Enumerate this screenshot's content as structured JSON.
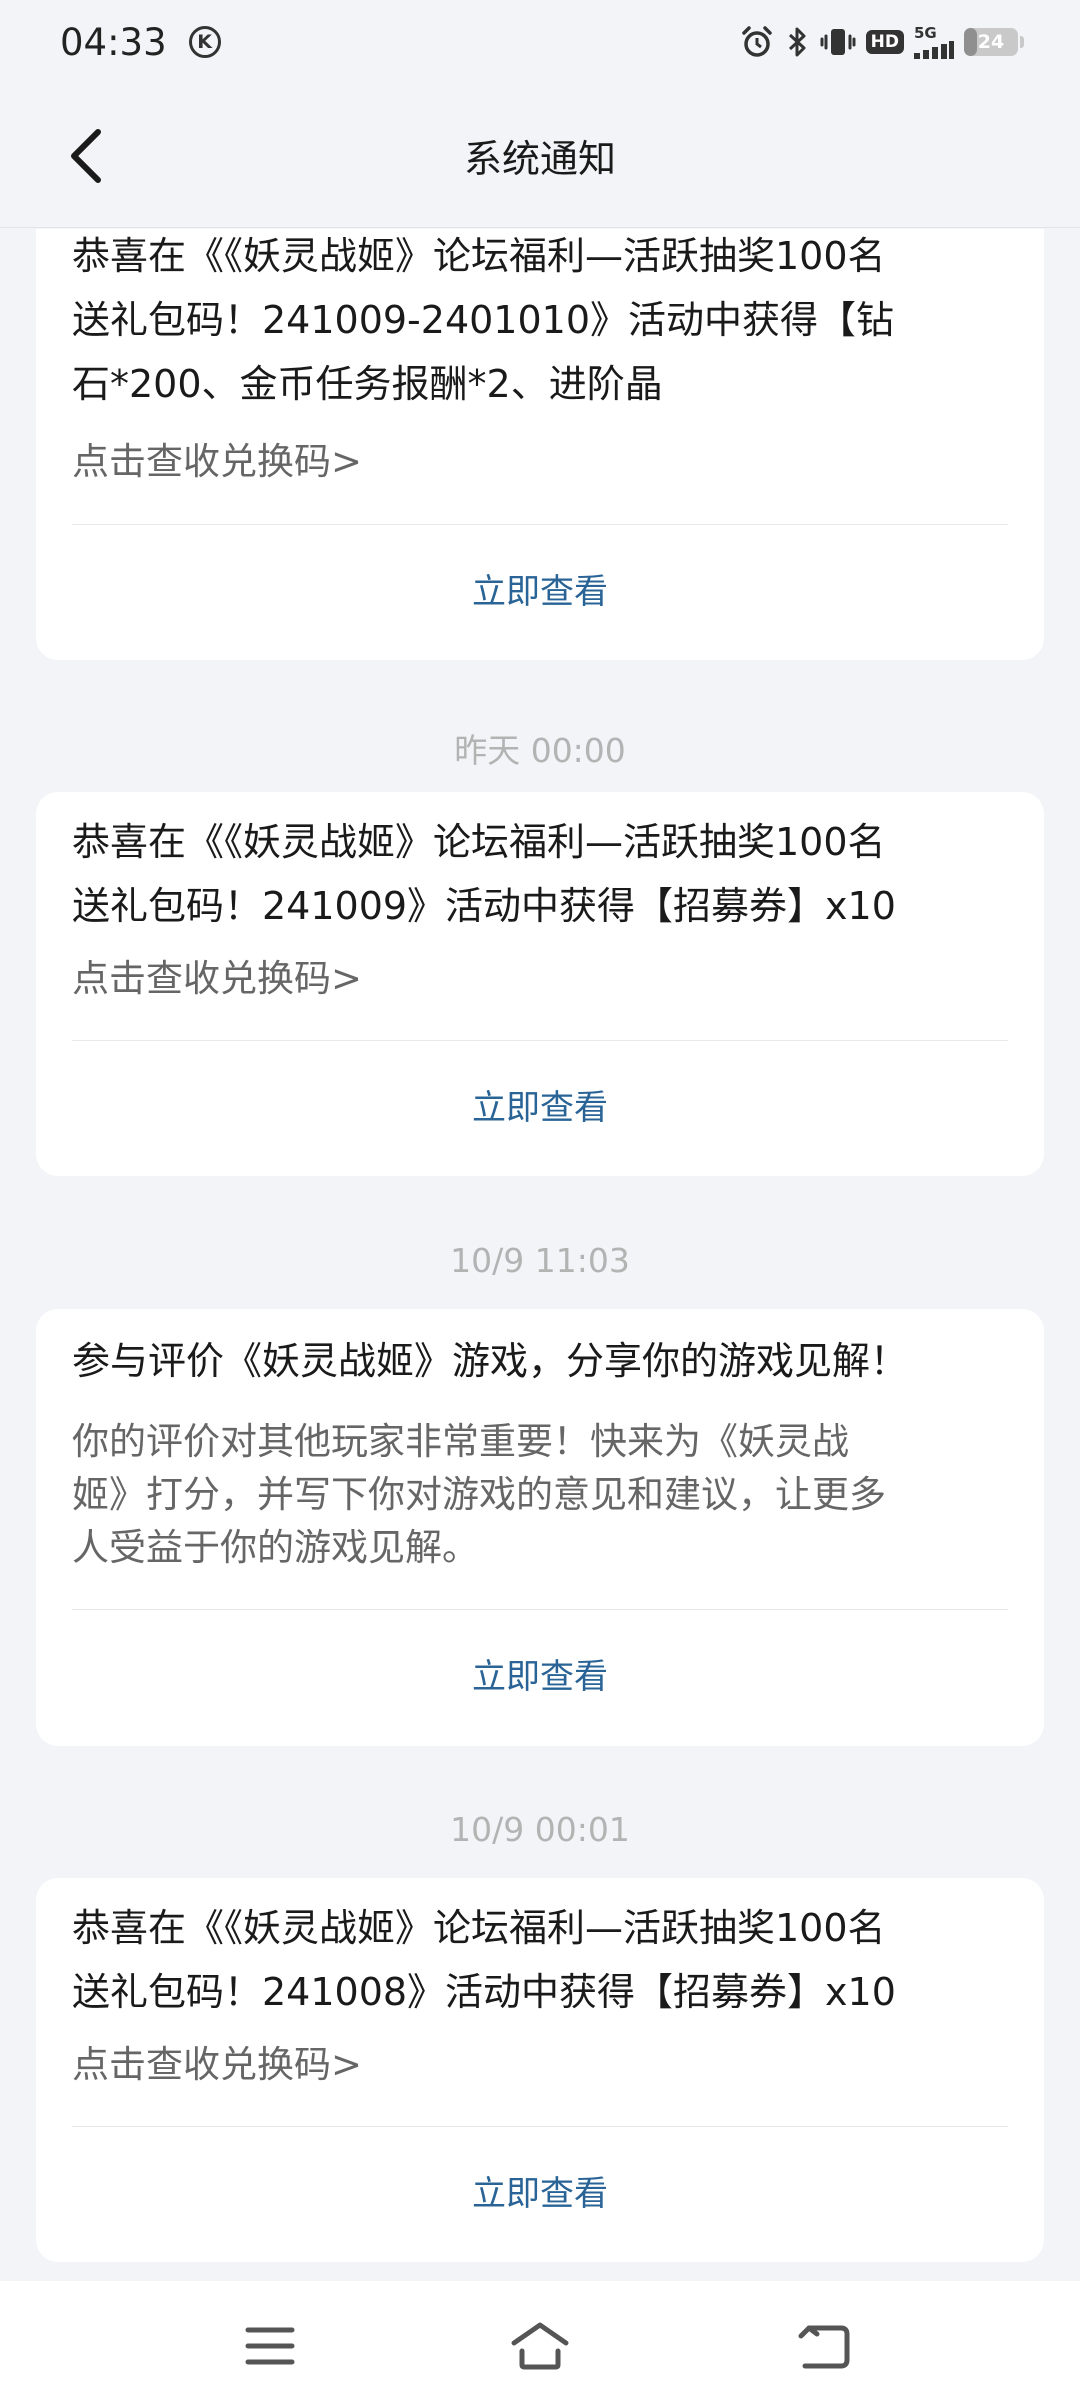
{
  "status_bar": {
    "time": "04:33",
    "k_badge": "K",
    "hd_label": "HD",
    "network_label": "5G",
    "battery_level": "24",
    "battery_fraction": 0.24,
    "icons": [
      "alarm-icon",
      "bluetooth-icon",
      "vibrate-icon",
      "hd-icon",
      "signal-icon",
      "battery-icon"
    ]
  },
  "header": {
    "title": "系统通知",
    "back_icon": "chevron-left-icon"
  },
  "notifications": [
    {
      "timestamp": "",
      "title_lines": [
        "恭喜在《《妖灵战姬》论坛福利—活跃抽奖100名",
        "送礼包码！241009-2401010》活动中获得【钻",
        "石*200、金币任务报酬*2、进阶晶"
      ],
      "subtitle_lines": [
        "点击查收兑换码>"
      ],
      "action": "立即查看"
    },
    {
      "timestamp": "昨天  00:00",
      "title_lines": [
        "恭喜在《《妖灵战姬》论坛福利—活跃抽奖100名",
        "送礼包码！241009》活动中获得【招募券】x10"
      ],
      "subtitle_lines": [
        "点击查收兑换码>"
      ],
      "action": "立即查看"
    },
    {
      "timestamp": "10/9  11:03",
      "title_lines": [
        "参与评价《妖灵战姬》游戏，分享你的游戏见解！"
      ],
      "subtitle_lines": [
        "你的评价对其他玩家非常重要！快来为《妖灵战",
        "姬》打分，并写下你对游戏的意见和建议，让更多",
        "人受益于你的游戏见解。"
      ],
      "action": "立即查看"
    },
    {
      "timestamp": "10/9  00:01",
      "title_lines": [
        "恭喜在《《妖灵战姬》论坛福利—活跃抽奖100名",
        "送礼包码！241008》活动中获得【招募券】x10"
      ],
      "subtitle_lines": [
        "点击查收兑换码>"
      ],
      "action": "立即查看"
    }
  ],
  "bottom_nav": {
    "icons": [
      "menu-icon",
      "home-icon",
      "back-icon"
    ]
  },
  "colors": {
    "background": "#f2f4f7",
    "card": "#ffffff",
    "action_link": "#2a6496",
    "timestamp": "#b3b3b3",
    "subtitle": "#666666"
  }
}
